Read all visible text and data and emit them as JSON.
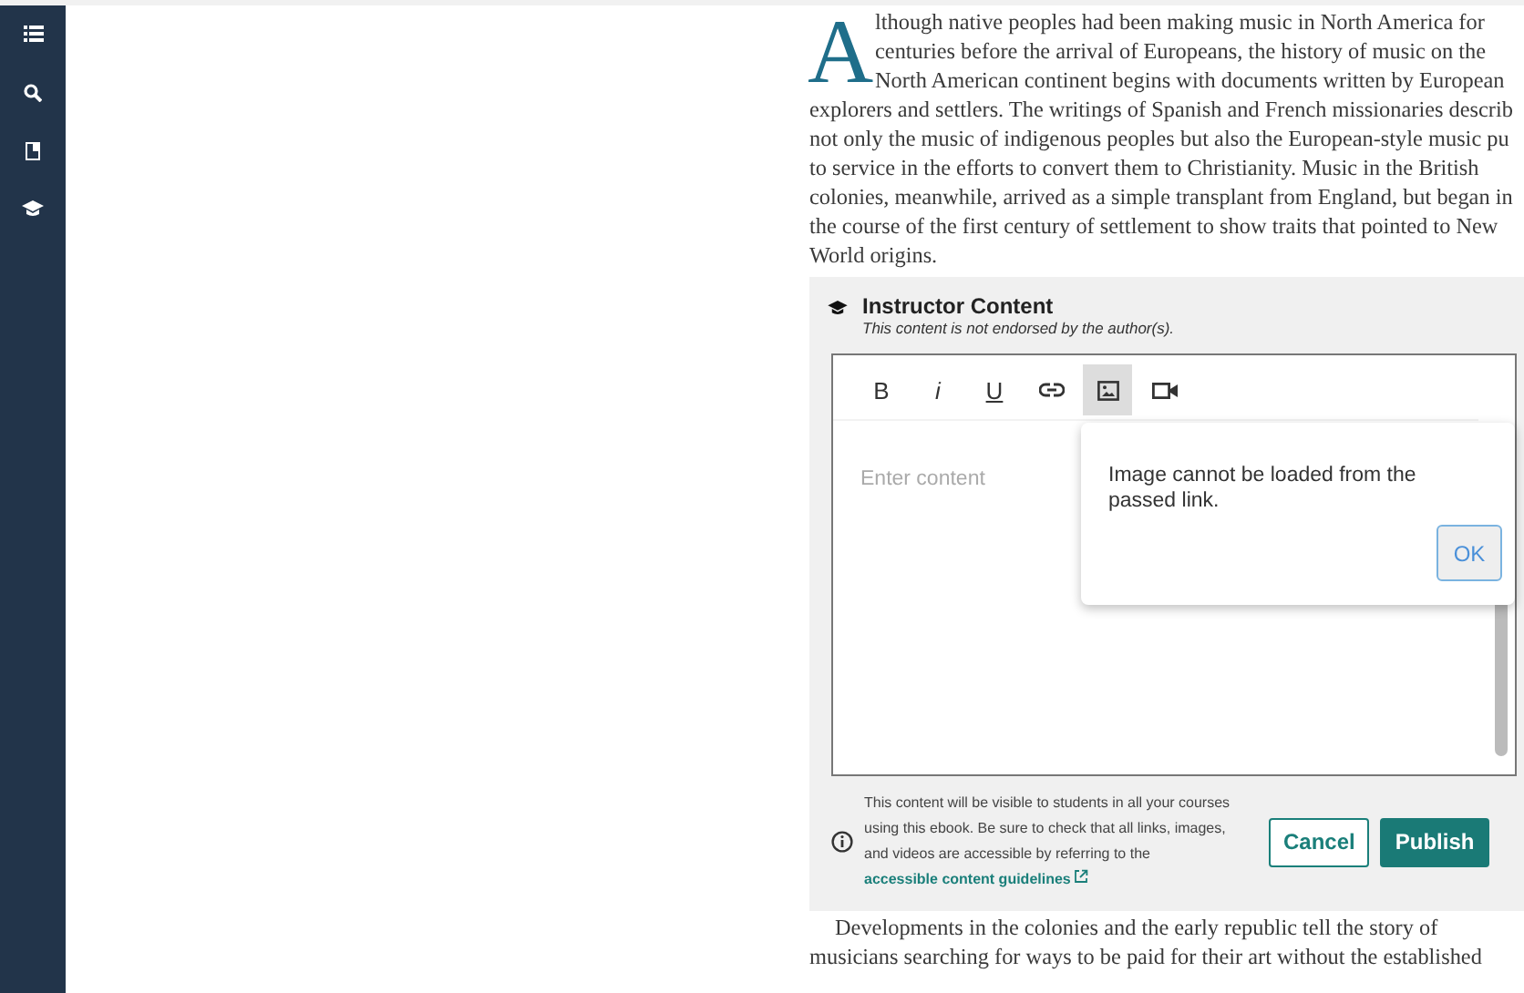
{
  "sidebar": {
    "items": [
      {
        "selected": false
      },
      {
        "selected": false
      },
      {
        "selected": false
      },
      {
        "selected": false
      }
    ]
  },
  "article": {
    "drop_cap": "A",
    "first_lines": [
      "lthough native peoples had been making music in North America for",
      "centuries before the arrival of Europeans, the history of music on the",
      "North American continent begins with documents written by European"
    ],
    "lines": [
      "explorers and settlers. The writings of Spanish and French missionaries describ",
      "not only the music of indigenous peoples but also the European-style music pu",
      "to service in the efforts to convert them to Christianity. Music in the British",
      "colonies, meanwhile, arrived as a simple transplant from England, but began in",
      "the course of the first century of settlement to show traits that pointed to New",
      "World origins."
    ],
    "next_lines": [
      "Developments in the colonies and the early republic tell the story of",
      "musicians searching for ways to be paid for their art without the established"
    ]
  },
  "instructor": {
    "title": "Instructor Content",
    "subtitle": "This content is not endorsed by the author(s).",
    "toolbar": [
      {
        "kind": "bold",
        "label": "B",
        "selected": false
      },
      {
        "kind": "italic",
        "label": "i",
        "selected": false
      },
      {
        "kind": "underline",
        "label": "U",
        "selected": false
      },
      {
        "kind": "link",
        "selected": false
      },
      {
        "kind": "image",
        "selected": true
      },
      {
        "kind": "video",
        "selected": false
      }
    ],
    "editor": {
      "placeholder": "Enter content"
    },
    "dialog": {
      "message": "Image cannot be loaded from the passed link.",
      "button": "OK"
    },
    "notice": "This content will be visible to students in all your courses using this ebook. Be sure to check that all links, images, and videos are accessible by referring to the ",
    "notice_link": "accessible content guidelines",
    "buttons": [
      {
        "kind": "secondary",
        "label": "Cancel"
      },
      {
        "kind": "primary",
        "label": "Publish"
      }
    ]
  }
}
